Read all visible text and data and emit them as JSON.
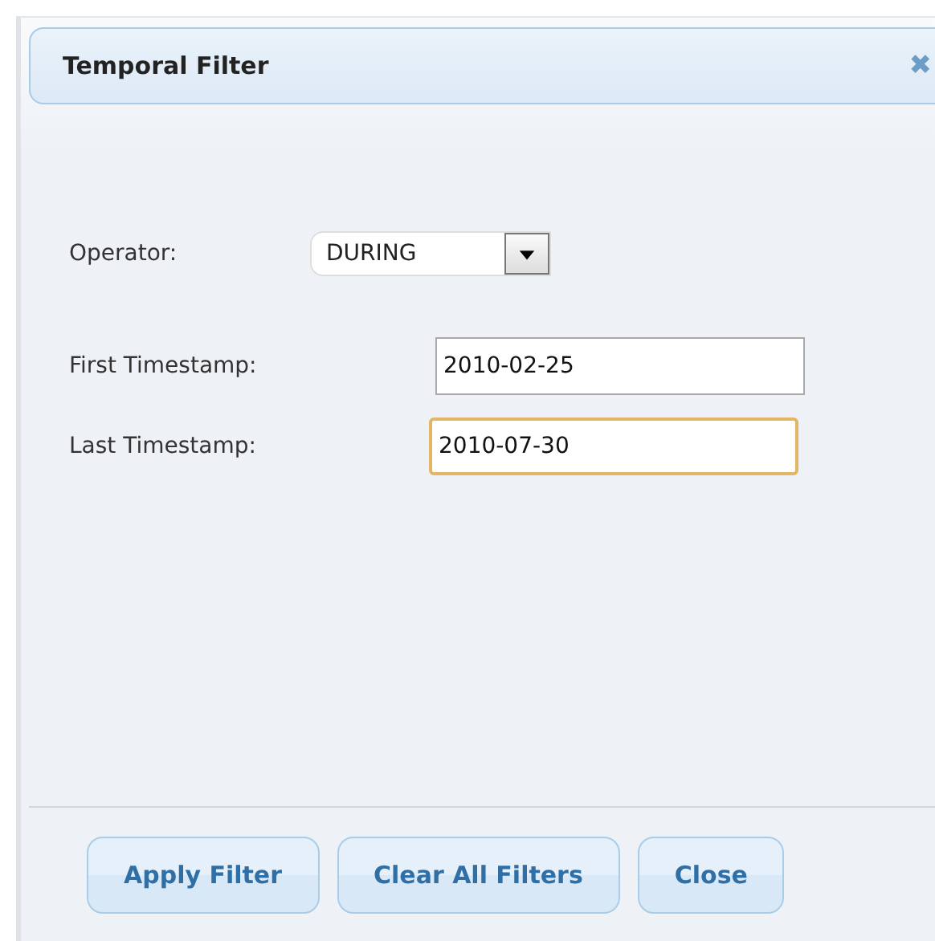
{
  "dialog": {
    "title": "Temporal Filter",
    "close_glyph": "✖"
  },
  "operator": {
    "label": "Operator:",
    "value": "DURING"
  },
  "fields": [
    {
      "label": "First Timestamp:",
      "value": "2010-02-25",
      "focused": false
    },
    {
      "label": "Last Timestamp:",
      "value": "2010-07-30",
      "focused": true
    }
  ],
  "buttons": [
    "Apply Filter",
    "Clear All Filters",
    "Close"
  ]
}
